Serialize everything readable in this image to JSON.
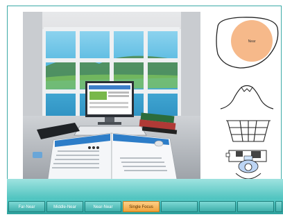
{
  "lens": {
    "near_label": "Near",
    "fill_color": "#f6b98a"
  },
  "tabs": [
    {
      "label": "Far-Near",
      "active": false
    },
    {
      "label": "Middle-Near",
      "active": false
    },
    {
      "label": "Near-Near",
      "active": false
    },
    {
      "label": "Single Focus",
      "active": true
    }
  ],
  "colors": {
    "accent_teal": "#3aa9a6",
    "active_tab": "#f0a23a"
  },
  "icons": [
    "lens-outline-icon",
    "mountain-view-icon",
    "window-grid-icon",
    "desk-workstation-icon"
  ]
}
